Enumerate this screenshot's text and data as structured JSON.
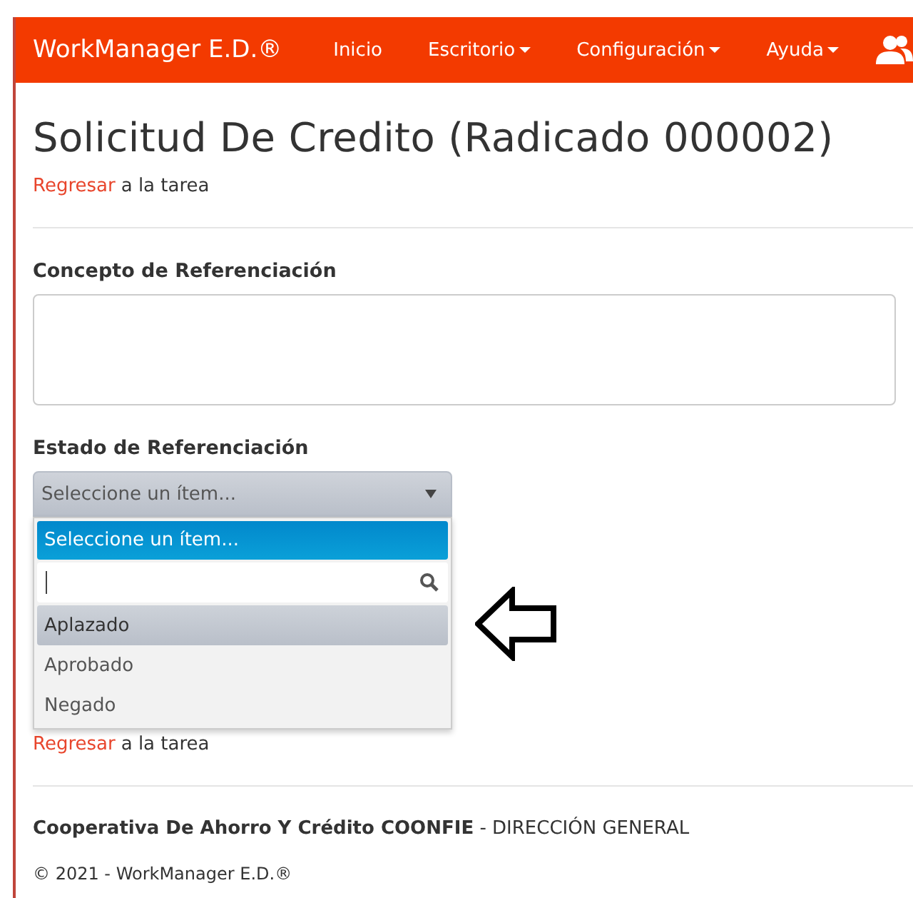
{
  "navbar": {
    "brand": "WorkManager E.D.®",
    "items": [
      {
        "label": "Inicio",
        "has_menu": false
      },
      {
        "label": "Escritorio",
        "has_menu": true
      },
      {
        "label": "Configuración",
        "has_menu": true
      },
      {
        "label": "Ayuda",
        "has_menu": true
      }
    ]
  },
  "title": "Solicitud De Credito (Radicado 000002)",
  "back_link": {
    "link": "Regresar",
    "text": "a la tarea"
  },
  "form": {
    "concept_label": "Concepto de Referenciación",
    "state_label": "Estado de Referenciación",
    "state_select": {
      "value": "Seleccione un ítem...",
      "expanded": true,
      "dropdown": {
        "header": "Seleccione un ítem...",
        "options": [
          {
            "label": "Aplazado",
            "highlighted": true
          },
          {
            "label": "Aprobado",
            "highlighted": false
          },
          {
            "label": "Negado",
            "highlighted": false
          }
        ]
      }
    }
  },
  "back_link_bottom": {
    "link": "Regresar",
    "text": "a la tarea"
  },
  "footer": {
    "org": "Cooperativa De Ahorro Y Crédito COONFIE",
    "unit": "- DIRECCIÓN GENERAL",
    "copyright": "© 2021 - WorkManager E.D.®"
  }
}
